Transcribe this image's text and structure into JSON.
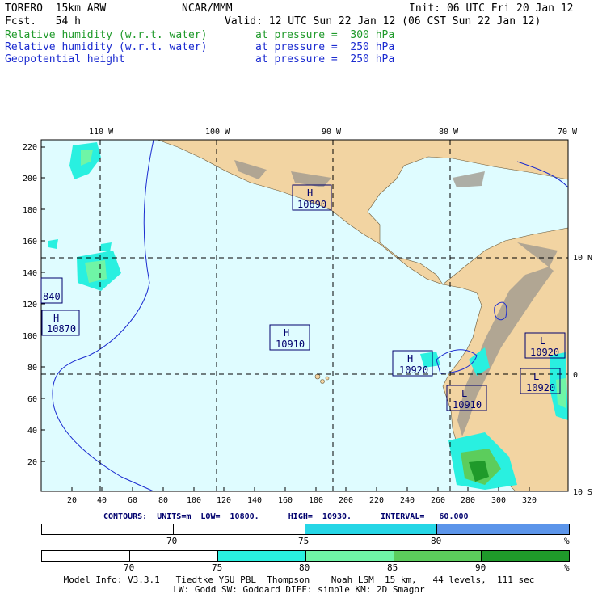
{
  "header": {
    "model": "TORERO  15km ARW",
    "org": "NCAR/MMM",
    "init": "Init: 06 UTC Fri 20 Jan 12",
    "fcst": "Fcst.   54 h",
    "valid": "Valid: 12 UTC Sun 22 Jan 12 (06 CST Sun 22 Jan 12)",
    "fields": [
      {
        "name": "Relative humidity (w.r.t. water)",
        "level": "at pressure =  300 hPa",
        "color": "#1f9a2a"
      },
      {
        "name": "Relative humidity (w.r.t. water)",
        "level": "at pressure =  250 hPa",
        "color": "#1b2bd0"
      },
      {
        "name": "Geopotential height",
        "level": "at pressure =  250 hPa",
        "color": "#1b2bd0"
      }
    ]
  },
  "map": {
    "top_lon_labels": [
      "110 W",
      "100 W",
      "90 W",
      "80 W",
      "70 W"
    ],
    "right_lat_labels": [
      "10 N",
      "0",
      "10 S"
    ],
    "y_ticks": [
      "220",
      "200",
      "180",
      "160",
      "140",
      "120",
      "100",
      "80",
      "60",
      "40",
      "20"
    ],
    "x_ticks": [
      "20",
      "40",
      "60",
      "80",
      "100",
      "120",
      "140",
      "160",
      "180",
      "200",
      "220",
      "240",
      "260",
      "280",
      "300",
      "320"
    ],
    "centers": [
      {
        "type": "H",
        "value": "10890"
      },
      {
        "type": "",
        "value": "840"
      },
      {
        "type": "H",
        "value": "10870"
      },
      {
        "type": "H",
        "value": "10910"
      },
      {
        "type": "H",
        "value": "10920"
      },
      {
        "type": "L",
        "value": "10910"
      },
      {
        "type": "L",
        "value": "10920"
      },
      {
        "type": "L",
        "value": "10920"
      }
    ],
    "ocean_color": "#dffcff",
    "land_color": "#f2d4a2"
  },
  "contours_text": "CONTOURS:  UNITS=m  LOW=  10800.      HIGH=  10930.      INTERVAL=   60.000",
  "bar1": {
    "labels": [
      "70",
      "75",
      "80",
      "%"
    ],
    "colors": [
      "#ffffff",
      "#ffffff",
      "#26d6e6",
      "#5c95ea"
    ]
  },
  "bar2": {
    "labels": [
      "70",
      "75",
      "80",
      "85",
      "90",
      "%"
    ],
    "colors": [
      "#ffffff",
      "#ffffff",
      "#ffffff",
      "#29f0e0",
      "#6ff5a6",
      "#5ccd5c",
      "#1f9a2a"
    ]
  },
  "footer": {
    "line1": "Model Info: V3.3.1   Tiedtke YSU PBL  Thompson    Noah LSM  15 km,   44 levels,  111 sec",
    "line2": "LW: Godd SW: Goddard DIFF: simple KM: 2D Smagor"
  }
}
